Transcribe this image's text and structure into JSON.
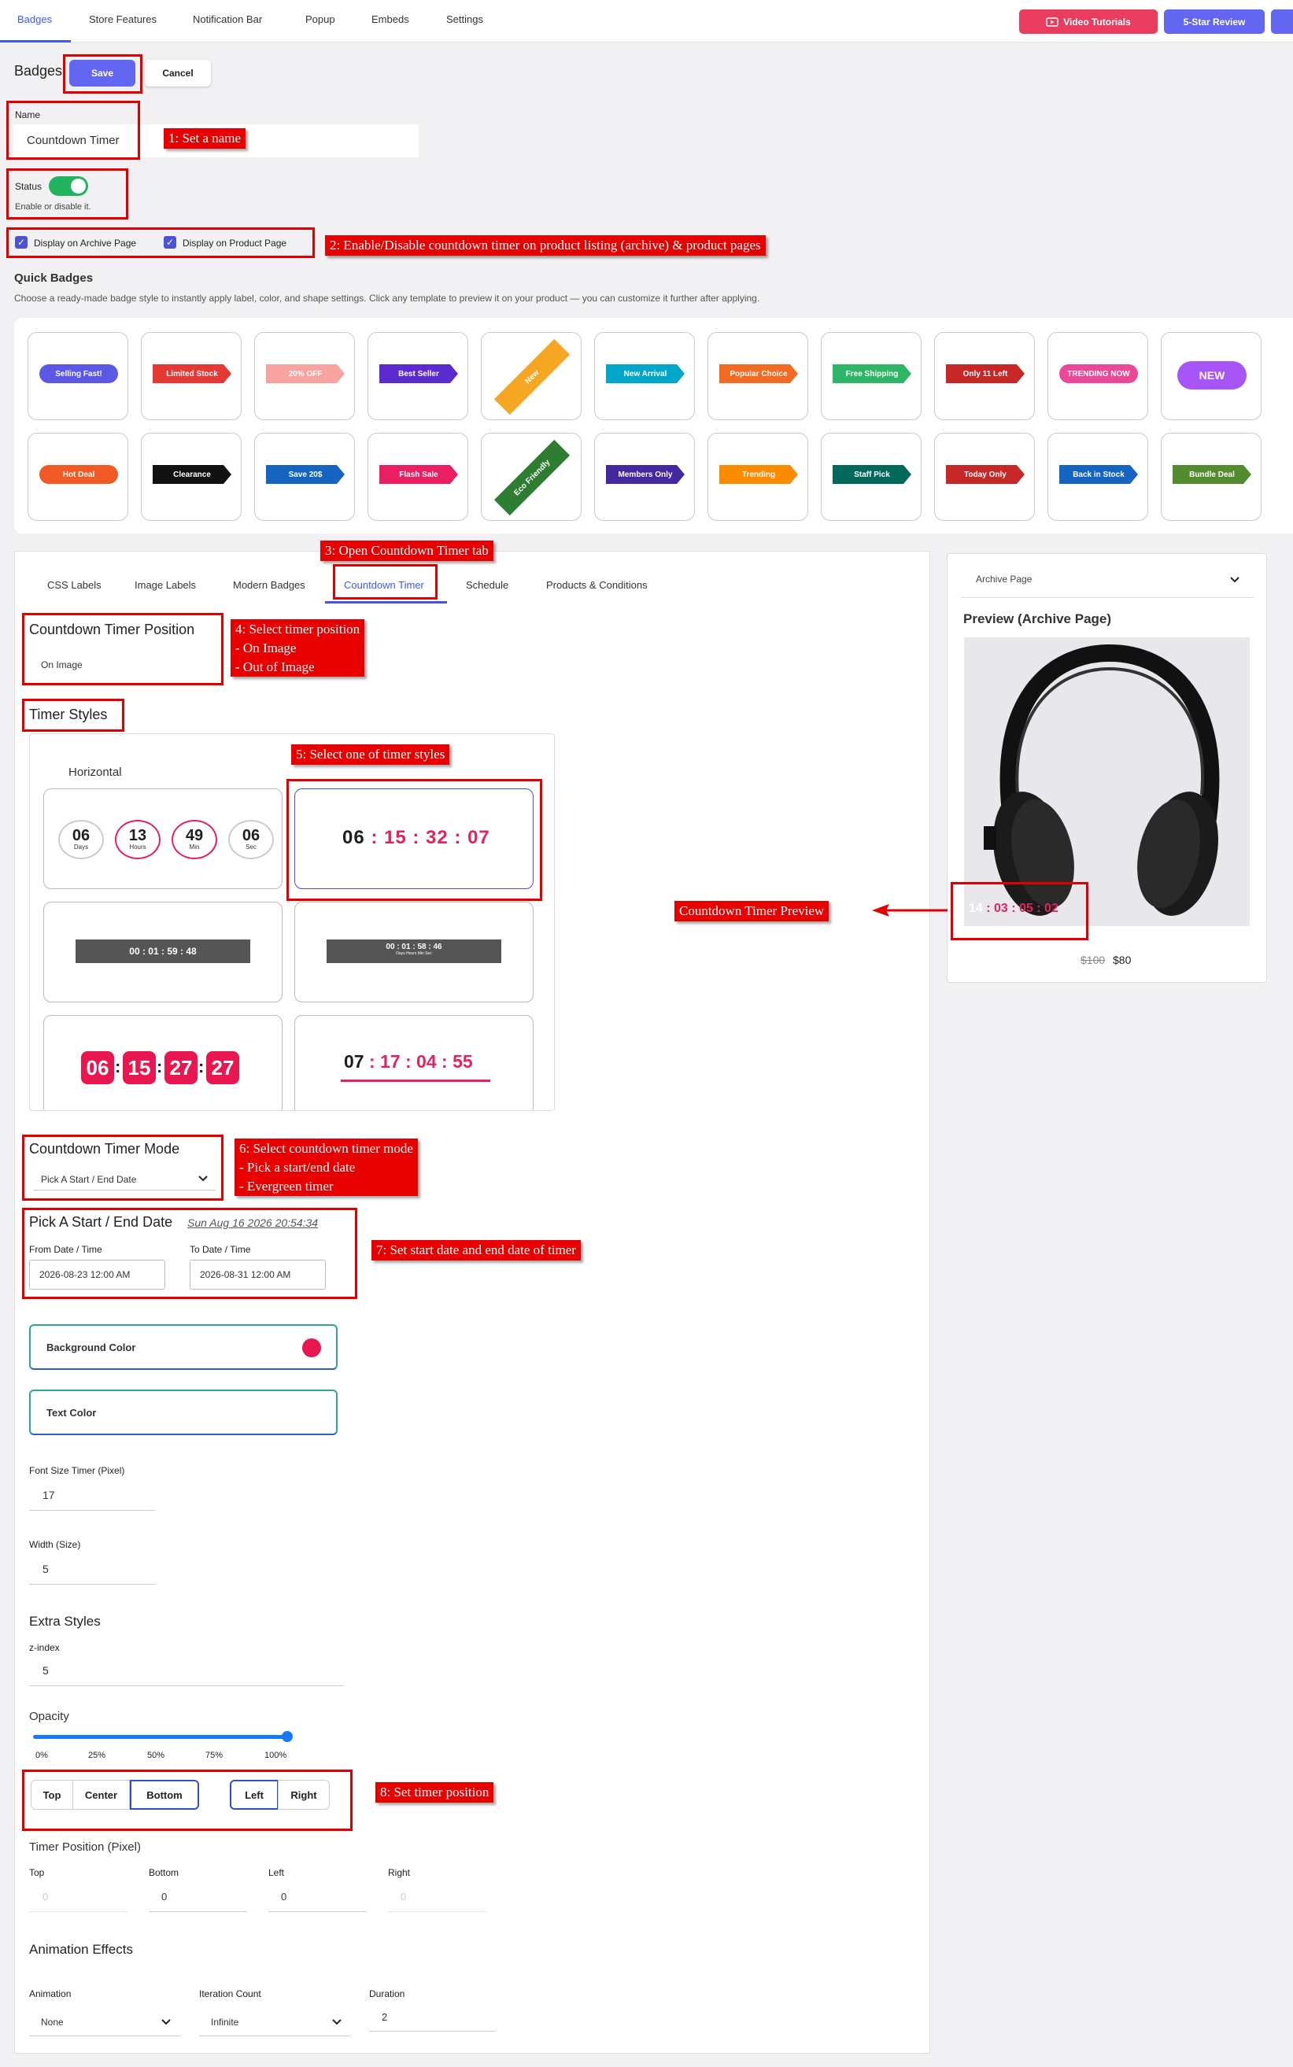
{
  "nav": {
    "tabs": [
      "Badges",
      "Store Features",
      "Notification Bar",
      "Popup",
      "Embeds",
      "Settings"
    ],
    "video_tutorials": "Video Tutorials",
    "five_star_review": "5-Star Review",
    "colors": {
      "video": "#e83d5e",
      "review": "#6366f1",
      "accent": "#3d5aff"
    }
  },
  "header": {
    "title": "Badges",
    "save": "Save",
    "cancel": "Cancel"
  },
  "name_field": {
    "label": "Name",
    "value": "Countdown Timer"
  },
  "status": {
    "label": "Status",
    "help": "Enable or disable it.",
    "enabled": true
  },
  "display": {
    "archive": "Display on Archive Page",
    "product": "Display on Product Page"
  },
  "quick_badges": {
    "title": "Quick Badges",
    "desc": "Choose a ready-made badge style to instantly apply label, color, and shape settings. Click any template to preview it on your product — you can customize it further after applying.",
    "row1": [
      {
        "label": "Selling Fast!",
        "color": "#5b58e6"
      },
      {
        "label": "Limited Stock",
        "color": "#e53935"
      },
      {
        "label": "20% OFF",
        "color": "#f9a3a0"
      },
      {
        "label": "Best Seller",
        "color": "#5b2bd0"
      },
      {
        "label": "New",
        "color": "#f5a623"
      },
      {
        "label": "New Arrival",
        "color": "#00a7c8"
      },
      {
        "label": "Popular Choice",
        "color": "#f26b22"
      },
      {
        "label": "Free Shipping",
        "color": "#2eb566"
      },
      {
        "label": "Only 11 Left",
        "color": "#c62828"
      },
      {
        "label": "TRENDING NOW",
        "color": "#ec4899"
      },
      {
        "label": "NEW",
        "color": "#a855f7"
      }
    ],
    "row2": [
      {
        "label": "Hot Deal",
        "color": "#f15a24"
      },
      {
        "label": "Clearance",
        "color": "#111111"
      },
      {
        "label": "Save 20$",
        "color": "#1565c0"
      },
      {
        "label": "Flash Sale",
        "color": "#e91e63"
      },
      {
        "label": "Eco Friendly",
        "color": "#2e7d32"
      },
      {
        "label": "Members Only",
        "color": "#4527a0"
      },
      {
        "label": "Trending",
        "color": "#fb8c00"
      },
      {
        "label": "Staff Pick",
        "color": "#00695c"
      },
      {
        "label": "Today Only",
        "color": "#c62828"
      },
      {
        "label": "Back in Stock",
        "color": "#1565c0"
      },
      {
        "label": "Bundle Deal",
        "color": "#558b2f"
      }
    ]
  },
  "settings_tabs": [
    "CSS Labels",
    "Image Labels",
    "Modern Badges",
    "Countdown Timer",
    "Schedule",
    "Products & Conditions"
  ],
  "timer_position": {
    "title": "Countdown Timer Position",
    "value": "On Image"
  },
  "timer_styles": {
    "title": "Timer Styles",
    "orientation": "Horizontal",
    "s1": {
      "values": [
        "06",
        "13",
        "49",
        "06"
      ],
      "units": [
        "Days",
        "Hours",
        "Min",
        "Sec"
      ]
    },
    "s2": {
      "d": "06",
      "rest": ": 15 : 32 : 07"
    },
    "s3": "00 : 01 : 59 : 48",
    "s4": {
      "time": "00 : 01 : 58 : 46",
      "units": "Days Hours Min Sec"
    },
    "s5": [
      "06",
      "15",
      "27",
      "27"
    ],
    "s6": {
      "d": "07",
      "rest": ": 17 : 04 : 55"
    }
  },
  "timer_mode": {
    "title": "Countdown Timer Mode",
    "value": "Pick A Start / End Date"
  },
  "dates": {
    "title": "Pick A Start / End Date",
    "now": "Sun Aug 16 2026 20:54:34",
    "from_label": "From Date / Time",
    "from": "2026-08-23 12:00 AM",
    "to_label": "To Date / Time",
    "to": "2026-08-31 12:00 AM"
  },
  "colors": {
    "bg_label": "Background Color",
    "bg": "#e8174f",
    "text_label": "Text Color"
  },
  "font_size": {
    "label": "Font Size Timer (Pixel)",
    "value": "17"
  },
  "width": {
    "label": "Width (Size)",
    "value": "5"
  },
  "extra": {
    "title": "Extra Styles",
    "zindex_label": "z-index",
    "zindex": "5"
  },
  "opacity": {
    "label": "Opacity",
    "value": 1.0,
    "ticks": [
      "0%",
      "25%",
      "50%",
      "75%",
      "100%"
    ]
  },
  "position_buttons": {
    "v": [
      "Top",
      "Center",
      "Bottom"
    ],
    "h": [
      "Left",
      "Right"
    ],
    "selected_v": "Bottom",
    "selected_h": "Left"
  },
  "pixel": {
    "title": "Timer Position (Pixel)",
    "labels": [
      "Top",
      "Bottom",
      "Left",
      "Right"
    ],
    "values": [
      "0",
      "0",
      "0",
      "0"
    ]
  },
  "animation": {
    "title": "Animation Effects",
    "anim_label": "Animation",
    "anim": "None",
    "iter_label": "Iteration Count",
    "iter": "Infinite",
    "dur_label": "Duration",
    "dur": "2"
  },
  "preview": {
    "page_select": "Archive Page",
    "title": "Preview (Archive Page)",
    "timer_d": "14",
    "timer_rest": ": 03 : 05 : 02",
    "old_price": "$100",
    "price": "$80"
  },
  "annotations": {
    "n1": "1: Set a name",
    "n2": "2: Enable/Disable countdown timer on product listing (archive) & product pages",
    "n3": "3: Open Countdown Timer tab",
    "n4a": "4: Select timer position",
    "n4b": "- On Image",
    "n4c": "- Out of Image",
    "n5": "5: Select one of timer styles",
    "n6a": "6: Select countdown timer mode",
    "n6b": "- Pick a start/end date",
    "n6c": "- Evergreen timer",
    "n7": "7: Set start date and end date of timer",
    "n8": "8: Set timer position",
    "preview_note": "Countdown Timer Preview"
  }
}
